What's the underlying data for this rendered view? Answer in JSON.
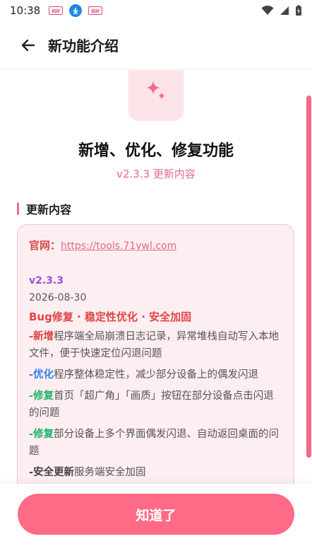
{
  "status_bar": {
    "time": "10:38",
    "notification_icons": [
      "app-badge-icon",
      "download-icon",
      "app-badge-icon"
    ],
    "right_icons": [
      "wifi-icon",
      "signal-icon",
      "battery-icon"
    ],
    "badge_text": "招好"
  },
  "app_bar": {
    "title": "新功能介绍",
    "back_icon": "arrow-left-icon"
  },
  "hero": {
    "icon": "sparkle-icon",
    "headline": "新增、优化、修复功能",
    "version_subtitle": "v2.3.3 更新内容"
  },
  "section": {
    "title": "更新内容"
  },
  "changelog": {
    "official_label": "官网：",
    "official_url": "https://tools.71ywl.com",
    "version": "v2.3.3",
    "date": "2026-08-30",
    "summary": "Bug修复 · 稳定性优化 · 安全加固",
    "entries": [
      {
        "tag": "-新增",
        "text": "程序端全局崩溃日志记录，异常堆栈自动写入本地文件，便于快速定位闪退问题"
      },
      {
        "tag": "-优化",
        "text": "程序整体稳定性，减少部分设备上的偶发闪退"
      },
      {
        "tag": "-修复",
        "text": "首页「超广角」「画质」按钮在部分设备点击闪退的问题"
      },
      {
        "tag": "-修复",
        "text": "部分设备上多个界面偶发闪退、自动返回桌面的问题"
      },
      {
        "tag": "-安全更新",
        "text": "服务端安全加固"
      }
    ]
  },
  "bottom": {
    "confirm_label": "知道了"
  },
  "colors": {
    "accent": "#ff6b86",
    "card_bg": "#fdeef1",
    "add": "#e04444",
    "optimize": "#2f80ed",
    "fix": "#21b36a"
  }
}
